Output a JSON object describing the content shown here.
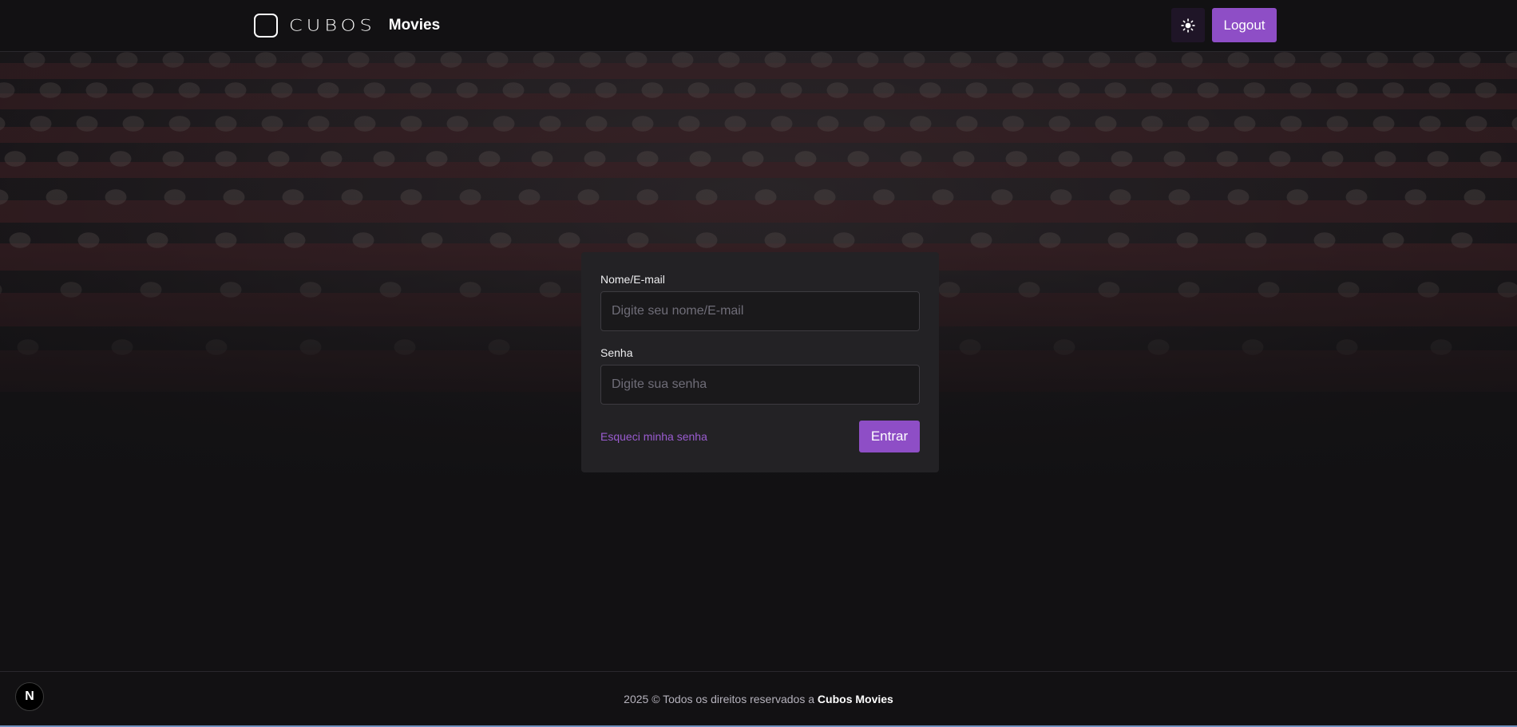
{
  "header": {
    "logo_text": "CUBOS",
    "brand_name": "Movies",
    "theme_icon": "sun-icon",
    "logout_label": "Logout"
  },
  "login_form": {
    "username_label": "Nome/E-mail",
    "username_placeholder": "Digite seu nome/E-mail",
    "username_value": "",
    "password_label": "Senha",
    "password_placeholder": "Digite sua senha",
    "password_value": "",
    "forgot_password_label": "Esqueci minha senha",
    "submit_label": "Entrar"
  },
  "footer": {
    "copyright_prefix": "2025 © Todos os direitos reservados a",
    "copyright_brand": "Cubos Movies"
  },
  "dev_badge": {
    "label": "N",
    "icon": "nextjs-icon"
  },
  "colors": {
    "accent": "#8e4ec6",
    "link": "#9a5cd0",
    "background": "#121113",
    "card": "#232225"
  }
}
